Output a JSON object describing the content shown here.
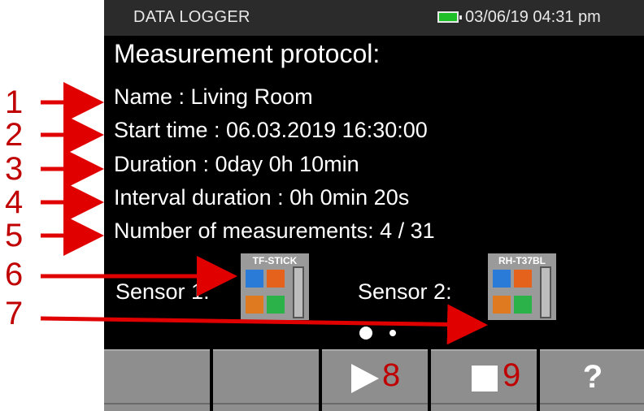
{
  "status_bar": {
    "title": "DATA LOGGER",
    "battery_color": "#1fbf2a",
    "datetime": "03/06/19 04:31 pm"
  },
  "protocol": {
    "heading": "Measurement protocol:",
    "name": "Name : Living Room",
    "start_time": "Start time : 06.03.2019 16:30:00",
    "duration": "Duration : 0day 0h 10min",
    "interval": "Interval duration : 0h 0min 20s",
    "measurements": "Number of measurements: 4 / 31"
  },
  "sensors": [
    {
      "label": "Sensor 1:",
      "model": "TF-STICK",
      "icon": "probe-sensor-icon"
    },
    {
      "label": "Sensor 2:",
      "model": "RH-T37BL",
      "icon": "probe-sensor-icon"
    }
  ],
  "pager": {
    "pages": 2,
    "active": 1
  },
  "function_keys": [
    {
      "label": "",
      "icon": ""
    },
    {
      "label": "",
      "icon": ""
    },
    {
      "label": "",
      "icon": "play-icon"
    },
    {
      "label": "",
      "icon": "stop-icon"
    },
    {
      "label": "?",
      "icon": "help-icon"
    }
  ],
  "callouts": [
    "1",
    "2",
    "3",
    "4",
    "5",
    "6",
    "7",
    "8",
    "9"
  ],
  "colors": {
    "callout": "#c00000",
    "screen_bg": "#000000",
    "fkey_bg": "#8e8e8e"
  }
}
